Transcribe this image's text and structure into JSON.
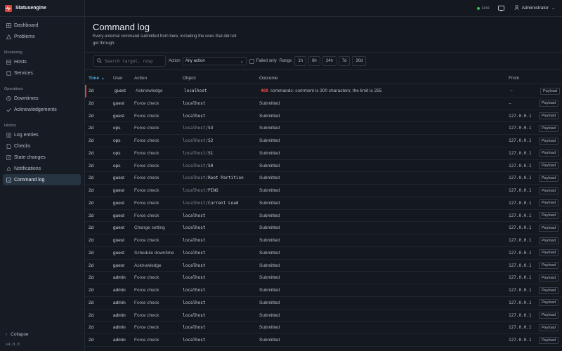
{
  "app": {
    "name": "Statusengine",
    "version": "v4.0.0"
  },
  "sidebar": {
    "top_items": [
      {
        "label": "Dashboard",
        "icon": "grid-icon"
      },
      {
        "label": "Problems",
        "icon": "warning-icon"
      }
    ],
    "sections": [
      {
        "title": "Monitoring",
        "items": [
          {
            "label": "Hosts",
            "icon": "server-icon"
          },
          {
            "label": "Services",
            "icon": "box-icon"
          }
        ]
      },
      {
        "title": "Operations",
        "items": [
          {
            "label": "Downtimes",
            "icon": "clock-icon"
          },
          {
            "label": "Acknowledgements",
            "icon": "check-icon"
          }
        ]
      },
      {
        "title": "History",
        "items": [
          {
            "label": "Log entries",
            "icon": "list-icon"
          },
          {
            "label": "Checks",
            "icon": "document-icon"
          },
          {
            "label": "State changes",
            "icon": "swap-icon"
          },
          {
            "label": "Notifications",
            "icon": "bell-icon"
          },
          {
            "label": "Command log",
            "icon": "terminal-icon",
            "active": true
          }
        ]
      }
    ],
    "collapse_label": "Collapse"
  },
  "topbar": {
    "live_label": "Live",
    "user_label": "Administrator"
  },
  "page": {
    "title": "Command log",
    "subtitle": "Every external command submitted from here, including the ones that did not get through."
  },
  "filters": {
    "search_placeholder": "Search target, resp",
    "action_label": "Action",
    "action_value": "Any action",
    "failed_only_label": "Failed only",
    "range_label": "Range",
    "ranges": [
      "1h",
      "6h",
      "24h",
      "7d",
      "30d"
    ]
  },
  "table": {
    "columns": {
      "time": "Time",
      "time_sort": "▲",
      "user": "User",
      "action": "Action",
      "object": "Object",
      "outcome": "Outcome",
      "from": "From"
    },
    "payload_label": "Payload",
    "rows": [
      {
        "time": "2d",
        "user": "guest",
        "action": "Acknowledge",
        "host": "localhost",
        "sub": "",
        "code": "400",
        "outcome": "commands: comment is 300 characters; the limit is 255",
        "from": "—",
        "error": true
      },
      {
        "time": "2d",
        "user": "guest",
        "action": "Force check",
        "host": "localhost",
        "sub": "",
        "code": "",
        "outcome": "Submitted",
        "from": "—",
        "error": false
      },
      {
        "time": "2d",
        "user": "guest",
        "action": "Force check",
        "host": "localhost",
        "sub": "",
        "code": "",
        "outcome": "Submitted",
        "from": "127.0.0.1",
        "error": false
      },
      {
        "time": "2d",
        "user": "ops",
        "action": "Force check",
        "host": "localhost/",
        "sub": "S3",
        "code": "",
        "outcome": "Submitted",
        "from": "127.0.0.1",
        "error": false
      },
      {
        "time": "2d",
        "user": "ops",
        "action": "Force check",
        "host": "localhost/",
        "sub": "S2",
        "code": "",
        "outcome": "Submitted",
        "from": "127.0.0.1",
        "error": false
      },
      {
        "time": "2d",
        "user": "ops",
        "action": "Force check",
        "host": "localhost/",
        "sub": "S1",
        "code": "",
        "outcome": "Submitted",
        "from": "127.0.0.1",
        "error": false
      },
      {
        "time": "2d",
        "user": "ops",
        "action": "Force check",
        "host": "localhost/",
        "sub": "S0",
        "code": "",
        "outcome": "Submitted",
        "from": "127.0.0.1",
        "error": false
      },
      {
        "time": "2d",
        "user": "guest",
        "action": "Force check",
        "host": "localhost/",
        "sub": "Root Partition",
        "code": "",
        "outcome": "Submitted",
        "from": "127.0.0.1",
        "error": false
      },
      {
        "time": "2d",
        "user": "guest",
        "action": "Force check",
        "host": "localhost/",
        "sub": "PING",
        "code": "",
        "outcome": "Submitted",
        "from": "127.0.0.1",
        "error": false
      },
      {
        "time": "2d",
        "user": "guest",
        "action": "Force check",
        "host": "localhost/",
        "sub": "Current Load",
        "code": "",
        "outcome": "Submitted",
        "from": "127.0.0.1",
        "error": false
      },
      {
        "time": "2d",
        "user": "guest",
        "action": "Force check",
        "host": "localhost",
        "sub": "",
        "code": "",
        "outcome": "Submitted",
        "from": "127.0.0.1",
        "error": false
      },
      {
        "time": "2d",
        "user": "guest",
        "action": "Change setting",
        "host": "localhost",
        "sub": "",
        "code": "",
        "outcome": "Submitted",
        "from": "127.0.0.1",
        "error": false
      },
      {
        "time": "2d",
        "user": "guest",
        "action": "Force check",
        "host": "localhost",
        "sub": "",
        "code": "",
        "outcome": "Submitted",
        "from": "127.0.0.1",
        "error": false
      },
      {
        "time": "2d",
        "user": "guest",
        "action": "Schedule downtime",
        "host": "localhost",
        "sub": "",
        "code": "",
        "outcome": "Submitted",
        "from": "127.0.0.1",
        "error": false
      },
      {
        "time": "2d",
        "user": "guest",
        "action": "Acknowledge",
        "host": "localhost",
        "sub": "",
        "code": "",
        "outcome": "Submitted",
        "from": "127.0.0.1",
        "error": false
      },
      {
        "time": "2d",
        "user": "admin",
        "action": "Force check",
        "host": "localhost",
        "sub": "",
        "code": "",
        "outcome": "Submitted",
        "from": "127.0.0.1",
        "error": false
      },
      {
        "time": "2d",
        "user": "admin",
        "action": "Force check",
        "host": "localhost",
        "sub": "",
        "code": "",
        "outcome": "Submitted",
        "from": "127.0.0.1",
        "error": false
      },
      {
        "time": "2d",
        "user": "admin",
        "action": "Force check",
        "host": "localhost",
        "sub": "",
        "code": "",
        "outcome": "Submitted",
        "from": "127.0.0.1",
        "error": false
      },
      {
        "time": "2d",
        "user": "admin",
        "action": "Force check",
        "host": "localhost",
        "sub": "",
        "code": "",
        "outcome": "Submitted",
        "from": "127.0.0.1",
        "error": false
      },
      {
        "time": "2d",
        "user": "admin",
        "action": "Force check",
        "host": "localhost",
        "sub": "",
        "code": "",
        "outcome": "Submitted",
        "from": "127.0.0.1",
        "error": false
      },
      {
        "time": "2d",
        "user": "admin",
        "action": "Force check",
        "host": "localhost",
        "sub": "",
        "code": "",
        "outcome": "Submitted",
        "from": "127.0.0.1",
        "error": false
      }
    ]
  },
  "colors": {
    "accent": "#4ea8de",
    "error": "#d9463e",
    "live": "#3fb950",
    "bg": "#14181f"
  }
}
